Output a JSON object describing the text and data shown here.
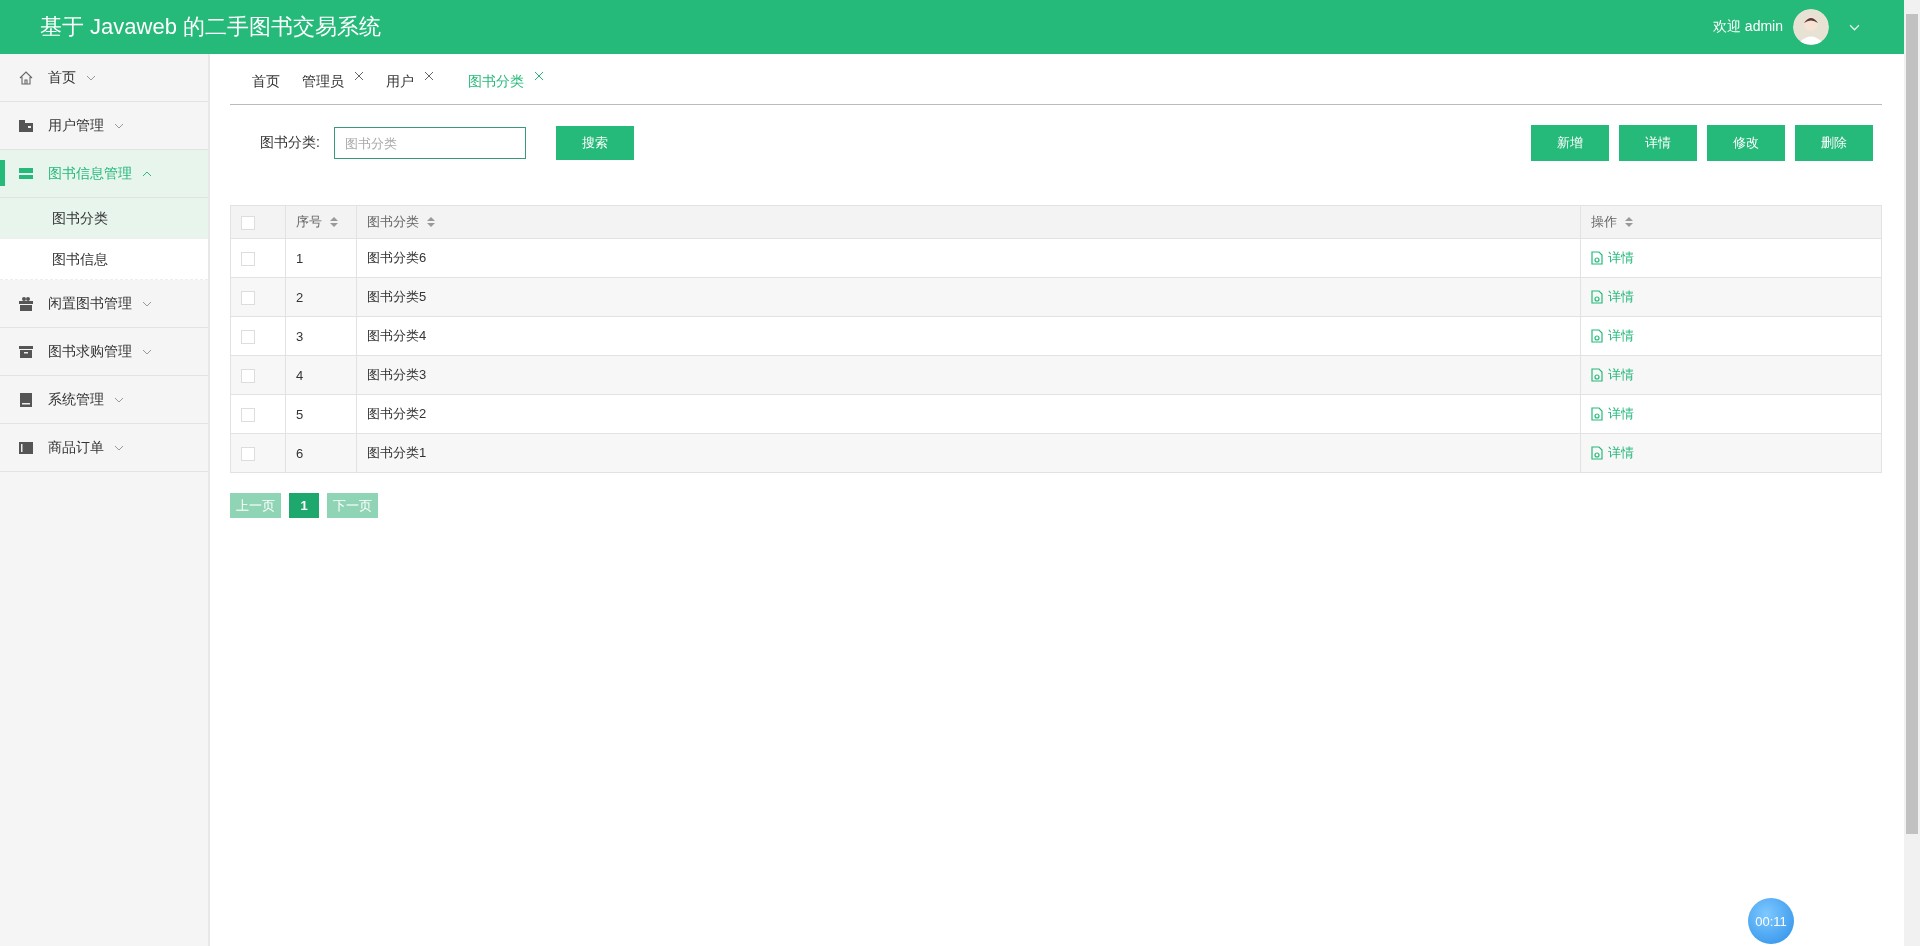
{
  "header": {
    "title": "基于 Javaweb 的二手图书交易系统",
    "welcome": "欢迎 admin"
  },
  "sidebar": {
    "items": [
      {
        "label": "首页",
        "expanded": false,
        "selected": false
      },
      {
        "label": "用户管理",
        "expanded": false,
        "selected": false
      },
      {
        "label": "图书信息管理",
        "expanded": true,
        "selected": true,
        "children": [
          {
            "label": "图书分类",
            "selected": true
          },
          {
            "label": "图书信息",
            "selected": false
          }
        ]
      },
      {
        "label": "闲置图书管理",
        "expanded": false,
        "selected": false
      },
      {
        "label": "图书求购管理",
        "expanded": false,
        "selected": false
      },
      {
        "label": "系统管理",
        "expanded": false,
        "selected": false
      },
      {
        "label": "商品订单",
        "expanded": false,
        "selected": false
      }
    ]
  },
  "tabs": [
    {
      "label": "首页",
      "closable": false,
      "selected": false
    },
    {
      "label": "管理员",
      "closable": true,
      "selected": false
    },
    {
      "label": "用户",
      "closable": true,
      "selected": false
    },
    {
      "label": "图书分类",
      "closable": true,
      "selected": true
    }
  ],
  "search": {
    "label": "图书分类:",
    "placeholder": "图书分类",
    "button": "搜索"
  },
  "actions": [
    "新增",
    "详情",
    "修改",
    "删除"
  ],
  "table": {
    "select_all_checked": false,
    "columns": [
      "序号",
      "图书分类",
      "操作"
    ],
    "rows": [
      {
        "checked": false,
        "cells": [
          "1",
          "图书分类6"
        ],
        "action": "详情"
      },
      {
        "checked": false,
        "cells": [
          "2",
          "图书分类5"
        ],
        "action": "详情"
      },
      {
        "checked": false,
        "cells": [
          "3",
          "图书分类4"
        ],
        "action": "详情"
      },
      {
        "checked": false,
        "cells": [
          "4",
          "图书分类3"
        ],
        "action": "详情"
      },
      {
        "checked": false,
        "cells": [
          "5",
          "图书分类2"
        ],
        "action": "详情"
      },
      {
        "checked": false,
        "cells": [
          "6",
          "图书分类1"
        ],
        "action": "详情"
      }
    ]
  },
  "pagination": {
    "prev": {
      "label": "上一页",
      "disabled": true
    },
    "pages": [
      {
        "label": "1",
        "selected": true
      }
    ],
    "next": {
      "label": "下一页",
      "disabled": true
    }
  },
  "recorder": {
    "time": "00:11"
  }
}
